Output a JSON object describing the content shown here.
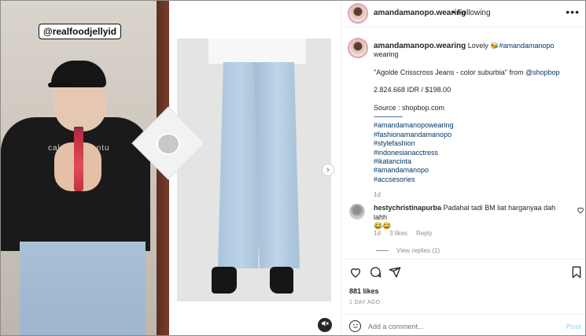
{
  "media": {
    "video_tag": "@realfoodjellyid",
    "shirt_text": "calon menantu",
    "next_icon": "chevron-right-icon",
    "mute_icon": "speaker-muted-icon"
  },
  "header": {
    "username": "amandamanopo.wearing",
    "separator": "•",
    "follow_label": "Following",
    "more_label": "•••"
  },
  "caption": {
    "username": "amandamanopo.wearing",
    "lead": "Lovely 🐝",
    "mention": "#amandamanopo",
    "lead_tail": " wearing",
    "product": "\"Agolde Crisscross Jeans - color suburbia\" from ",
    "product_link": "@shopbop",
    "price": "2.824.668 IDR / $198.00",
    "source": "Source : shopbop.com",
    "divider": "------------------",
    "hashtags": [
      "#amandamanopowearing",
      "#fashionamandamanopo",
      "#stylefashion",
      "#indonesianacctress",
      "#ikatancinta",
      "#amandamanopo",
      "#accsesories"
    ],
    "time": "1d"
  },
  "comment": {
    "username": "hestychristinapurba",
    "text": " Padahal tadi BM liat harganyaa dah lahh",
    "emojis": "😂😂",
    "time": "1d",
    "likes": "3 likes",
    "reply": "Reply",
    "view_replies": "View replies (1)"
  },
  "actions": {
    "like_icon": "heart-icon",
    "comment_icon": "comment-icon",
    "share_icon": "share-icon",
    "save_icon": "bookmark-icon"
  },
  "stats": {
    "likes": "881 likes",
    "ago": "1 DAY AGO"
  },
  "add_comment": {
    "placeholder": "Add a comment...",
    "post_label": "Post"
  }
}
